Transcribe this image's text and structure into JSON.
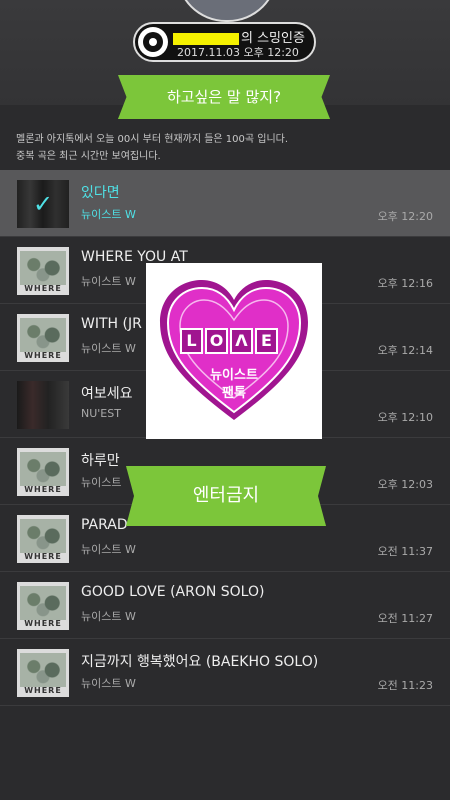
{
  "header": {
    "badge_suffix": "의 스밍인증",
    "date": "2017.11.03",
    "time": "오후 12:20",
    "highlight_color": "#f4f000"
  },
  "banner_top": "하고싶은 말 많지?",
  "banner_mid": "엔터금지",
  "notice": {
    "line1": "멜론과 아지톡에서 오늘 00시 부터 현재까지 들은 100곡 입니다.",
    "line2": "중복 곡은 최근 시간만 보여집니다."
  },
  "songs": [
    {
      "title": "있다면",
      "artist": "뉴이스트 W",
      "time": "오후 12:20",
      "thumb": "group-photo",
      "selected": true
    },
    {
      "title": "WHERE YOU AT",
      "artist": "뉴이스트 W",
      "time": "오후 12:16",
      "thumb": "where-album"
    },
    {
      "title": "WITH (JR",
      "artist": "뉴이스트 W",
      "time": "오후 12:14",
      "thumb": "where-album"
    },
    {
      "title": "여보세요",
      "artist": "NU'EST",
      "time": "오후 12:10",
      "thumb": "group-photo"
    },
    {
      "title": "하루만",
      "artist": "뉴이스트",
      "time": "오후 12:03",
      "thumb": "where-album"
    },
    {
      "title": "PARAD",
      "artist": "뉴이스트 W",
      "time": "오전 11:37",
      "thumb": "where-album"
    },
    {
      "title": "GOOD LOVE (ARON SOLO)",
      "artist": "뉴이스트 W",
      "time": "오전 11:27",
      "thumb": "where-album"
    },
    {
      "title": "지금까지 행복했어요 (BAEKHO SOLO)",
      "artist": "뉴이스트 W",
      "time": "오전 11:23",
      "thumb": "where-album"
    }
  ],
  "album_text": "WHERE",
  "overlay": {
    "letters": [
      "L",
      "O",
      "Λ",
      "E"
    ],
    "line1": "뉴이스트",
    "line2": "팬톡",
    "heart_color": "#e02fc8",
    "accent_color": "#4fe1e6",
    "green": "#7cc63a"
  }
}
